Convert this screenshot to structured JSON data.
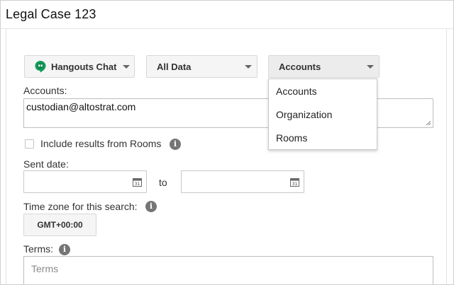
{
  "page": {
    "title": "Legal Case 123"
  },
  "filters": {
    "service": {
      "label": "Hangouts Chat",
      "icon": "hangouts-chat-icon"
    },
    "data": {
      "label": "All Data"
    },
    "scope": {
      "label": "Accounts"
    }
  },
  "scope_menu": {
    "items": [
      "Accounts",
      "Organization",
      "Rooms"
    ]
  },
  "accounts": {
    "label": "Accounts:",
    "value": "custodian@altostrat.com"
  },
  "rooms": {
    "label": "Include results from Rooms",
    "checked": false
  },
  "sent_date": {
    "label": "Sent date:",
    "separator": "to"
  },
  "timezone": {
    "label": "Time zone for this search:",
    "value": "GMT+00:00"
  },
  "terms": {
    "label": "Terms:",
    "placeholder": "Terms"
  },
  "colors": {
    "hangouts_green": "#0f9d58",
    "info_gray": "#757575",
    "menu_border": "#c8c8c8"
  }
}
